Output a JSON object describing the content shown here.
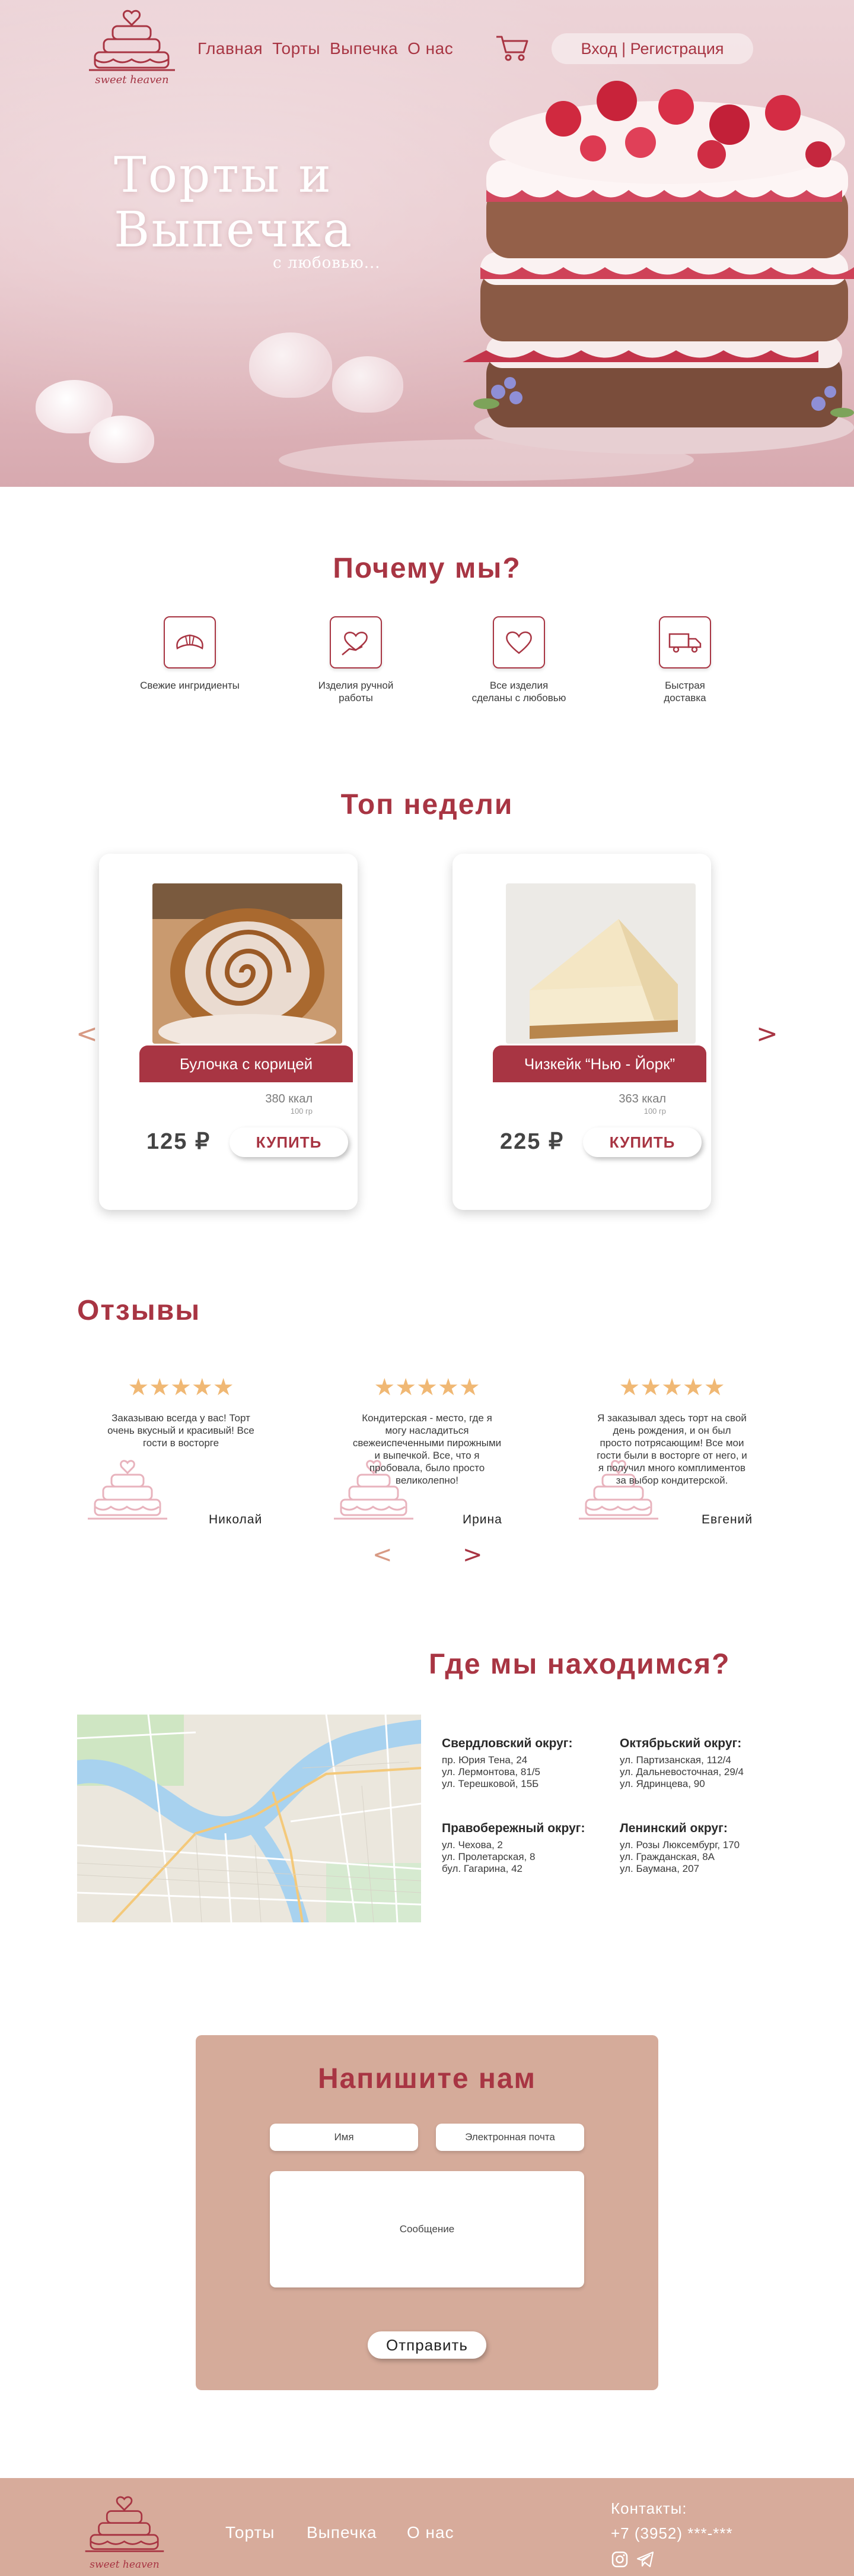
{
  "brand": {
    "name": "sweet heaven"
  },
  "nav": {
    "items": [
      "Главная",
      "Торты",
      "Выпечка",
      "О нас"
    ],
    "login_label": "Вход | Регистрация"
  },
  "hero": {
    "title_line1": "Торты и",
    "title_line2": "Выпечка",
    "subtitle": "с любовью..."
  },
  "why": {
    "title": "Почему мы?",
    "features": [
      {
        "icon": "croissant-icon",
        "line1": "Свежие ингридиенты",
        "line2": ""
      },
      {
        "icon": "handmade-heart-icon",
        "line1": "Изделия ручной",
        "line2": "работы"
      },
      {
        "icon": "heart-icon",
        "line1": "Все изделия",
        "line2": "сделаны с любовью"
      },
      {
        "icon": "truck-icon",
        "line1": "Быстрая",
        "line2": "доставка"
      }
    ]
  },
  "top_week": {
    "title": "Топ недели",
    "prev_arrow": "<",
    "next_arrow": ">",
    "products": [
      {
        "name": "Булочка с корицей",
        "kcal": "380 ккал",
        "weight": "100 гр",
        "price": "125 ₽",
        "buy_label": "КУПИТЬ"
      },
      {
        "name": "Чизкейк “Нью - Йорк”",
        "kcal": "363 ккал",
        "weight": "100 гр",
        "price": "225 ₽",
        "buy_label": "КУПИТЬ"
      }
    ]
  },
  "reviews": {
    "title": "Отзывы",
    "stars": "★★★★★",
    "prev_arrow": "<",
    "next_arrow": ">",
    "items": [
      {
        "lines": [
          "Заказываю всегда у вас! Торт",
          "очень вкусный и красивый! Все",
          "гости в восторге"
        ],
        "name": "Николай",
        "rating": 5
      },
      {
        "lines": [
          "Кондитерская - место, где я",
          "могу насладиться",
          "свежеиспеченными пирожными",
          "и выпечкой. Все, что я",
          "пробовала, было просто",
          "великолепно!"
        ],
        "name": "Ирина",
        "rating": 5
      },
      {
        "lines": [
          "Я заказывал здесь торт на свой",
          "день рождения, и он был",
          "просто потрясающим! Все мои",
          "гости были в восторге от него, и",
          "я получил много комплиментов",
          "за выбор кондитерской."
        ],
        "name": "Евгений",
        "rating": 5
      }
    ]
  },
  "location": {
    "title": "Где мы находимся?",
    "districts": [
      {
        "name": "Свердловский округ:",
        "addresses": [
          "пр. Юрия Тена, 24",
          "ул. Лермонтова, 81/5",
          "ул. Терешковой, 15Б"
        ]
      },
      {
        "name": "Октябрьский округ:",
        "addresses": [
          "ул. Партизанская, 112/4",
          "ул. Дальневосточная, 29/4",
          "ул. Ядринцева, 90"
        ]
      },
      {
        "name": "Правобережный округ:",
        "addresses": [
          "ул. Чехова, 2",
          "ул. Пролетарская, 8",
          "бул. Гагарина, 42"
        ]
      },
      {
        "name": "Ленинский округ:",
        "addresses": [
          "ул. Розы Люксембург, 170",
          "ул. Гражданская, 8А",
          "ул. Баумана, 207"
        ]
      }
    ]
  },
  "contact_form": {
    "title": "Напишите нам",
    "name_placeholder": "Имя",
    "email_placeholder": "Электронная почта",
    "message_placeholder": "Сообщение",
    "submit_label": "Отправить"
  },
  "footer": {
    "nav": [
      "Торты",
      "Выпечка",
      "О нас"
    ],
    "contacts_title": "Контакты:",
    "phone": "+7 (3952) ***-***",
    "social_icons": [
      "instagram-icon",
      "telegram-icon"
    ]
  },
  "colors": {
    "accent": "#a83543",
    "star": "#f0b874",
    "form_bg": "#d5ab9a",
    "footer_bg": "#d7ab9b",
    "hero_bg": "#e6c3c8"
  }
}
